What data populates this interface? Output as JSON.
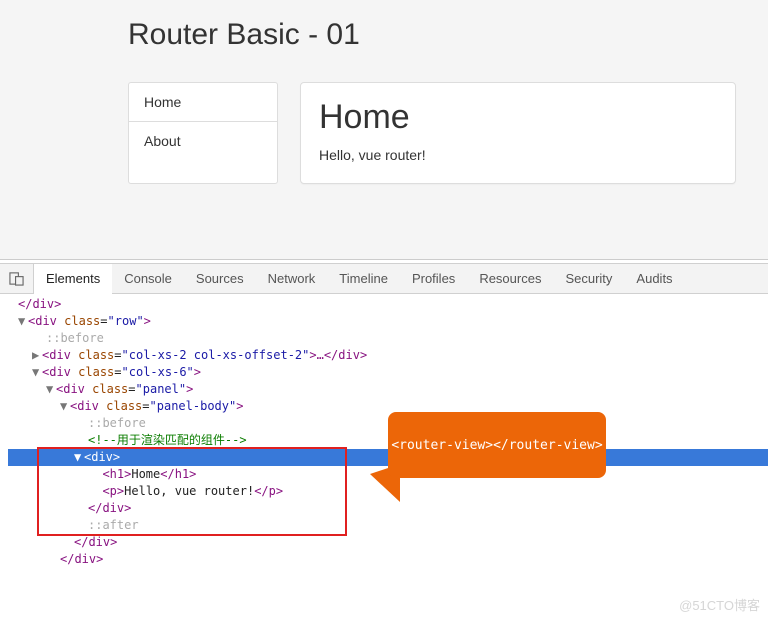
{
  "page": {
    "title": "Router Basic - 01",
    "nav": {
      "items": [
        "Home",
        "About"
      ]
    },
    "panel": {
      "heading": "Home",
      "text": "Hello, vue router!"
    }
  },
  "devtools": {
    "tabs": [
      "Elements",
      "Console",
      "Sources",
      "Network",
      "Timeline",
      "Profiles",
      "Resources",
      "Security",
      "Audits"
    ],
    "activeTab": 0
  },
  "dom": {
    "l0": "</div>",
    "row": {
      "tag": "div",
      "cls": "row"
    },
    "before": "::before",
    "col1": {
      "tag": "div",
      "cls": "col-xs-2 col-xs-offset-2",
      "trail": ">…</div>"
    },
    "col2": {
      "tag": "div",
      "cls": "col-xs-6"
    },
    "panel": {
      "tag": "div",
      "cls": "panel"
    },
    "panelBody": {
      "tag": "div",
      "cls": "panel-body"
    },
    "comment": "<!--用于渲染匹配的组件-->",
    "selDiv": "<div>",
    "h1": {
      "open": "<h1>",
      "text": "Home",
      "close": "</h1>"
    },
    "p": {
      "open": "<p>",
      "text": "Hello, vue router!",
      "close": "</p>"
    },
    "closeDiv": "</div>",
    "after": "::after"
  },
  "callout": {
    "text": "<router-view></router-view>"
  },
  "watermark": "@51CTO博客"
}
